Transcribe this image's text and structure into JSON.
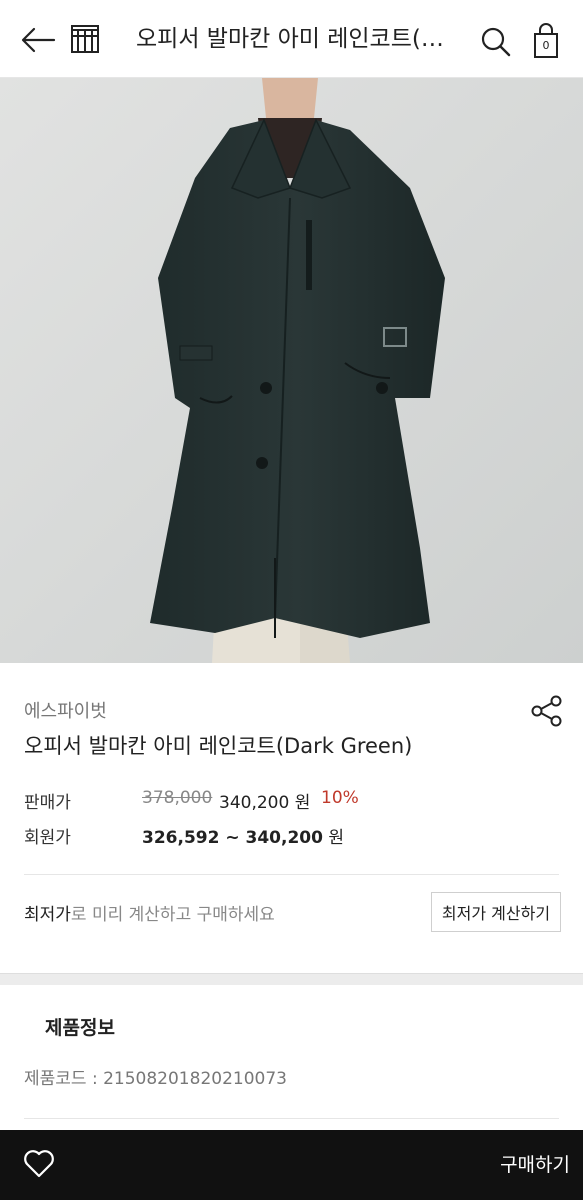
{
  "header": {
    "title": "오피서 발마칸 아미 레인코트(Dark Green)",
    "cart_count": "0",
    "back_icon": "arrow-left-icon",
    "home_icon": "store-icon",
    "search_icon": "search-icon",
    "cart_icon": "shopping-bag-icon"
  },
  "product": {
    "brand": "에스파이벗",
    "name": "오피서 발마칸 아미 레인코트(Dark Green)",
    "share_icon": "share-icon",
    "image_icon": "product-photo"
  },
  "prices": {
    "sale_label": "판매가",
    "original": "378,000",
    "sale": "340,200 원",
    "discount": "10%",
    "member_label": "회원가",
    "member_range": "326,592 ~ 340,200",
    "member_unit": " 원"
  },
  "lowest": {
    "bold": "최저가",
    "rest": "로 미리 계산하고 구매하세요",
    "button": "최저가 계산하기"
  },
  "info": {
    "title": "제품정보",
    "code": "제품코드 : 21508201820210073"
  },
  "bottom": {
    "wish_icon": "heart-icon",
    "buy": "구매하기"
  },
  "colors": {
    "accent_discount": "#c0392b",
    "bottom_bar": "#111111"
  }
}
